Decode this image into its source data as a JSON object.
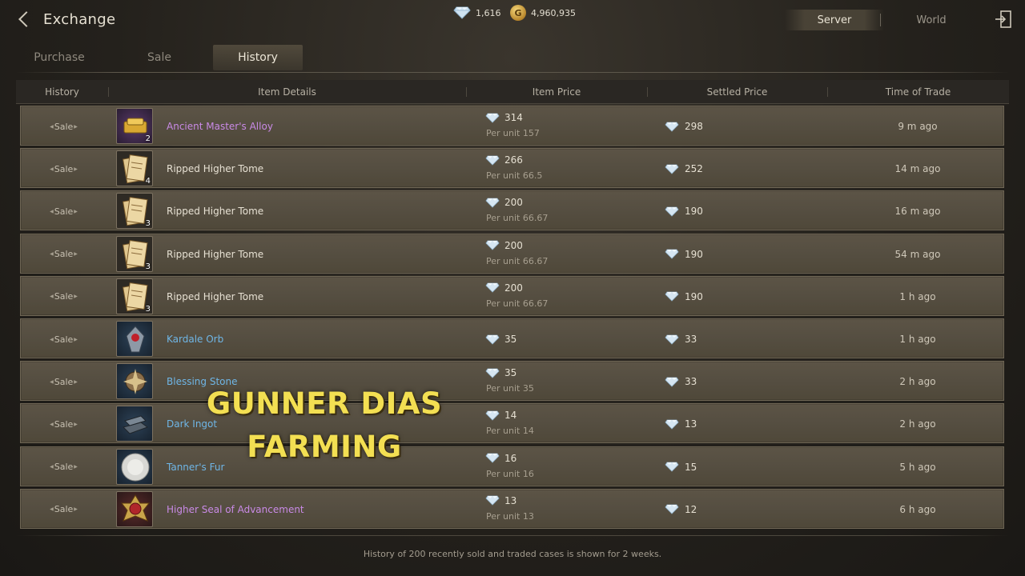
{
  "header": {
    "title": "Exchange",
    "diamonds": "1,616",
    "gold": "4,960,935",
    "server_label": "Server",
    "world_label": "World"
  },
  "tabs": [
    {
      "label": "Purchase"
    },
    {
      "label": "Sale"
    },
    {
      "label": "History"
    }
  ],
  "columns": [
    "History",
    "Item Details",
    "Item Price",
    "Settled Price",
    "Time of Trade"
  ],
  "rows": [
    {
      "type": "Sale",
      "name": "Ancient Master's Alloy",
      "qty": "2",
      "price": "314",
      "per_unit": "Per unit  157",
      "settled": "298",
      "time": "9 m ago",
      "rarity": "purple",
      "icon": "alloy-icon"
    },
    {
      "type": "Sale",
      "name": "Ripped Higher Tome",
      "qty": "4",
      "price": "266",
      "per_unit": "Per unit  66.5",
      "settled": "252",
      "time": "14 m ago",
      "rarity": "white",
      "icon": "tome-icon"
    },
    {
      "type": "Sale",
      "name": "Ripped Higher Tome",
      "qty": "3",
      "price": "200",
      "per_unit": "Per unit  66.67",
      "settled": "190",
      "time": "16 m ago",
      "rarity": "white",
      "icon": "tome-icon"
    },
    {
      "type": "Sale",
      "name": "Ripped Higher Tome",
      "qty": "3",
      "price": "200",
      "per_unit": "Per unit  66.67",
      "settled": "190",
      "time": "54 m ago",
      "rarity": "white",
      "icon": "tome-icon"
    },
    {
      "type": "Sale",
      "name": "Ripped Higher Tome",
      "qty": "3",
      "price": "200",
      "per_unit": "Per unit  66.67",
      "settled": "190",
      "time": "1 h ago",
      "rarity": "white",
      "icon": "tome-icon"
    },
    {
      "type": "Sale",
      "name": "Kardale Orb",
      "qty": "",
      "price": "35",
      "per_unit": "",
      "settled": "33",
      "time": "1 h ago",
      "rarity": "blue",
      "icon": "orb-icon"
    },
    {
      "type": "Sale",
      "name": "Blessing Stone",
      "qty": "",
      "price": "35",
      "per_unit": "Per unit  35",
      "settled": "33",
      "time": "2 h ago",
      "rarity": "blue",
      "icon": "stone-icon"
    },
    {
      "type": "Sale",
      "name": "Dark Ingot",
      "qty": "",
      "price": "14",
      "per_unit": "Per unit  14",
      "settled": "13",
      "time": "2 h ago",
      "rarity": "blue",
      "icon": "ingot-icon"
    },
    {
      "type": "Sale",
      "name": "Tanner's Fur",
      "qty": "",
      "price": "16",
      "per_unit": "Per unit  16",
      "settled": "15",
      "time": "5 h ago",
      "rarity": "blue",
      "icon": "fur-icon"
    },
    {
      "type": "Sale",
      "name": "Higher Seal of Advancement",
      "qty": "",
      "price": "13",
      "per_unit": "Per unit  13",
      "settled": "12",
      "time": "6 h ago",
      "rarity": "purple",
      "icon": "seal-icon"
    }
  ],
  "footer": "History of 200 recently sold and traded cases is shown for 2 weeks.",
  "overlay": [
    "GUNNER DIAS",
    "FARMING"
  ]
}
